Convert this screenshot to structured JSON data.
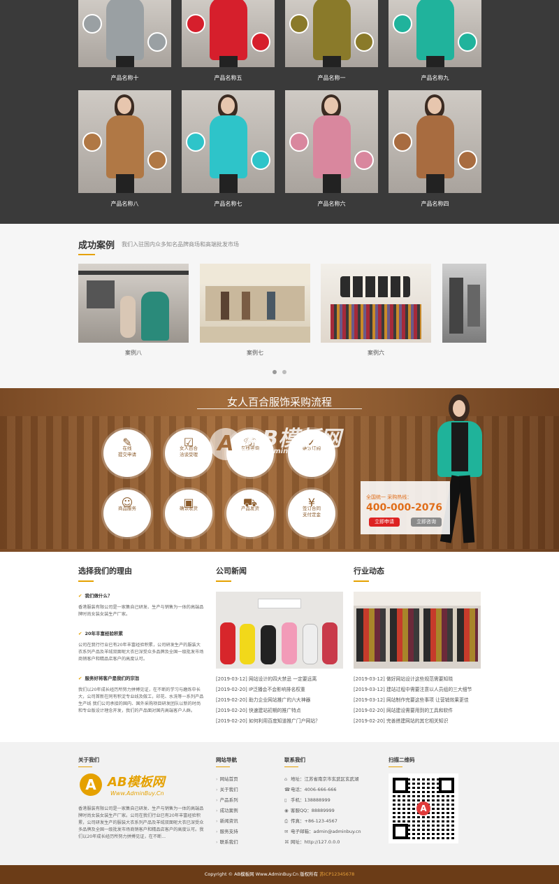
{
  "products": [
    {
      "name": "产品名称十",
      "coat": "#9aa0a3"
    },
    {
      "name": "产品名称五",
      "coat": "#d61f2c"
    },
    {
      "name": "产品名称一",
      "coat": "#8a7a2a"
    },
    {
      "name": "产品名称九",
      "coat": "#20b39c"
    },
    {
      "name": "产品名称八",
      "coat": "#b07845"
    },
    {
      "name": "产品名称七",
      "coat": "#2ec4c9"
    },
    {
      "name": "产品名称六",
      "coat": "#d9879e"
    },
    {
      "name": "产品名称四",
      "coat": "#a86c40"
    }
  ],
  "cases": {
    "title": "成功案例",
    "subtitle": "我们入驻国内众多知名品牌商场和高端批发市场",
    "items": [
      "案例八",
      "案例七",
      "案例六"
    ]
  },
  "process": {
    "title": "女人百合服饰采购流程",
    "steps": [
      {
        "label1": "在线",
        "label2": "提交申请",
        "icon": "✎"
      },
      {
        "label1": "女人百合",
        "label2": "洽谈受理",
        "icon": "☑"
      },
      {
        "label1": "在线咨询",
        "label2": "",
        "icon": "☏"
      },
      {
        "label1": "确认订购",
        "label2": "",
        "icon": "✓"
      },
      {
        "label1": "商品服务",
        "label2": "",
        "icon": "☺"
      },
      {
        "label1": "确认收货",
        "label2": "",
        "icon": "▣"
      },
      {
        "label1": "产品发货",
        "label2": "",
        "icon": "⛟"
      },
      {
        "label1": "签订合同",
        "label2": "支付定金",
        "icon": "¥"
      }
    ],
    "watermark": "AB模板网",
    "watermark_url": "Www.AdminBuy.Cn",
    "call_text": "全国统一 采购热线：",
    "phone": "400-000-2076",
    "btn_apply": "立即申请",
    "btn_consult": "立即咨询"
  },
  "reasons": {
    "title": "选择我们的理由",
    "items": [
      {
        "heading": "我们做什么？",
        "text": "香港服装有限公司是一家集自己研发、生产与销售为一体的高端品牌时尚女装女装生产厂家。"
      },
      {
        "heading": "20年丰富经验积累",
        "text": "公司在我行行业已有20年丰富经验积累，公司研发生产的服装大衣系列产品及羊绒双面呢大衣已深受众多品牌及全国一级批发市场商销客户和精品店客户的高度认可。"
      },
      {
        "heading": "服务好将客户是我们的宗旨",
        "text": "我们以20年成长经历所努力拼搏见证，在不断的学习与磨炼中长大，公司首新在同有积淀专业线及做工，印花、水洗等一系列产品生产线 我们公司承接的国内、国外采购项目研发团队以新的时尚和专业版设计理念开发，我们的产品面对国内高端客户人群。"
      }
    ]
  },
  "news": {
    "title": "公司新闻",
    "items": [
      "[2019-03-12] 网站设计的四大禁忌 一定要远离",
      "[2019-02-20] IP泛播会不会影响排名权重",
      "[2019-02-20] 助力企业网站推广的六大神器",
      "[2019-02-20] 快速建站初期的推广特点",
      "[2019-02-20] 如何利用百度知道推广门户网站？"
    ]
  },
  "industry": {
    "title": "行业动态",
    "items": [
      "[2019-03-12] 做好网站设计这些规范需要知晓",
      "[2019-03-12] 建站过程中需要注意以人员组的三大细节",
      "[2019-03-12] 网站制作完要这些事项 让营销效果更佳",
      "[2019-02-20] 网站建设需要用到的工具和软件",
      "[2019-02-20] 完善搭建网站的其它相关知识"
    ]
  },
  "footer": {
    "about_title": "关于我们",
    "about_logo": "AB模板网",
    "about_logo_url": "Www.AdminBuy.Cn",
    "about_text": "香港服装有限公司是一家集自己研发、生产与销售为一体的高端品牌时尚女装女装生产厂家。公司在我们行业已有20年丰富经验积累，公司研发生产的服装大衣系列产品及羊绒双面呢大衣已深受众多品牌及全国一级批发市场商销客户和精品店客户的高度认可。我们以20年成长经历所努力拼搏见证，在不断...",
    "nav_title": "网站导航",
    "nav": [
      "网站首页",
      "关于我们",
      "产品系列",
      "成功案例",
      "新闻资讯",
      "服务支持",
      "联系我们"
    ],
    "contact_title": "联系我们",
    "contact": [
      {
        "icon": "⌂",
        "text": "地址：江苏省南京市玄武区玄武湖"
      },
      {
        "icon": "☎",
        "text": "电话：4006-666-666"
      },
      {
        "icon": "▯",
        "text": "手机：138888999"
      },
      {
        "icon": "◉",
        "text": "客服QQ：88889999"
      },
      {
        "icon": "⎙",
        "text": "传真：+86-123-4567"
      },
      {
        "icon": "✉",
        "text": "电子邮箱：admin@adminbuy.cn"
      },
      {
        "icon": "⌘",
        "text": "网址：http://127.0.0.0"
      }
    ],
    "qr_title": "扫描二维码",
    "copyright": "Copyright © AB模板网 Www.AdminBuy.Cn 版权所有",
    "icp": "苏ICP12345678"
  },
  "colors": {
    "accent": "#e5a100",
    "brown": "#6b3c17",
    "dark": "#3a3a3a"
  }
}
